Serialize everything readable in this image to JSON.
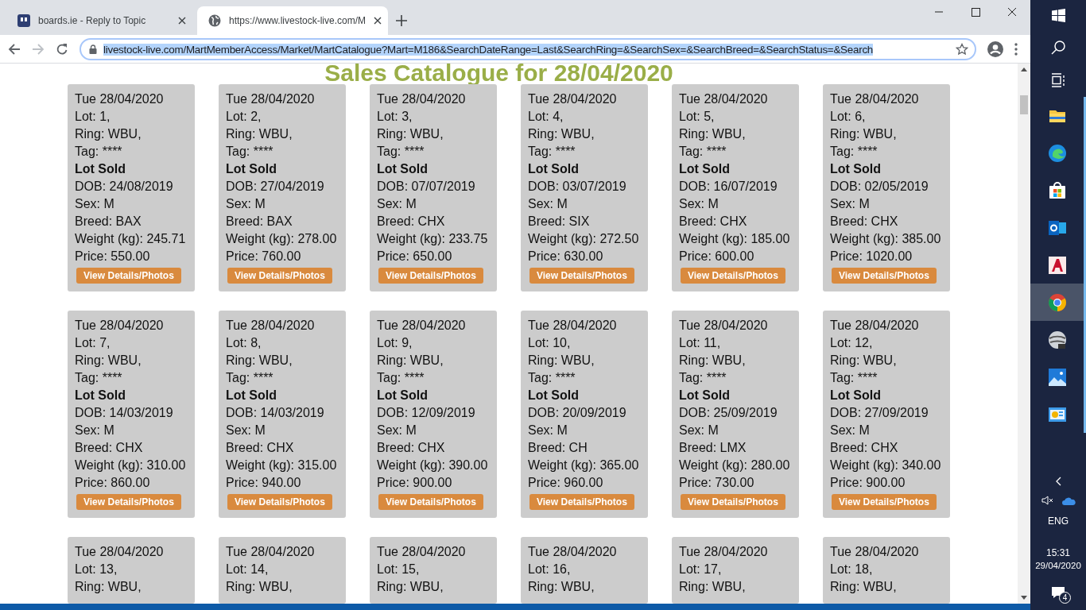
{
  "tabs": [
    {
      "title": "boards.ie - Reply to Topic",
      "selected": false
    },
    {
      "title": "https://www.livestock-live.com/M",
      "selected": true
    }
  ],
  "address_bar": {
    "url": "livestock-live.com/MartMemberAccess/Market/MartCatalogue?Mart=M186&SearchDateRange=Last&SearchRing=&SearchSex=&SearchBreed=&SearchStatus=&Search"
  },
  "page": {
    "title": "Sales Catalogue for 28/04/2020",
    "lots": [
      {
        "date": "Tue 28/04/2020",
        "lot": "Lot: 1,",
        "ring": "Ring: WBU,",
        "tag": "Tag: ****",
        "status": "Lot Sold",
        "dob": "DOB: 24/08/2019",
        "sex": "Sex: M",
        "breed": "Breed: BAX",
        "weight": "Weight (kg): 245.71",
        "price": "Price: 550.00",
        "button": "View Details/Photos"
      },
      {
        "date": "Tue 28/04/2020",
        "lot": "Lot: 2,",
        "ring": "Ring: WBU,",
        "tag": "Tag: ****",
        "status": "Lot Sold",
        "dob": "DOB: 27/04/2019",
        "sex": "Sex: M",
        "breed": "Breed: BAX",
        "weight": "Weight (kg): 278.00",
        "price": "Price: 760.00",
        "button": "View Details/Photos"
      },
      {
        "date": "Tue 28/04/2020",
        "lot": "Lot: 3,",
        "ring": "Ring: WBU,",
        "tag": "Tag: ****",
        "status": "Lot Sold",
        "dob": "DOB: 07/07/2019",
        "sex": "Sex: M",
        "breed": "Breed: CHX",
        "weight": "Weight (kg): 233.75",
        "price": "Price: 650.00",
        "button": "View Details/Photos"
      },
      {
        "date": "Tue 28/04/2020",
        "lot": "Lot: 4,",
        "ring": "Ring: WBU,",
        "tag": "Tag: ****",
        "status": "Lot Sold",
        "dob": "DOB: 03/07/2019",
        "sex": "Sex: M",
        "breed": "Breed: SIX",
        "weight": "Weight (kg): 272.50",
        "price": "Price: 630.00",
        "button": "View Details/Photos"
      },
      {
        "date": "Tue 28/04/2020",
        "lot": "Lot: 5,",
        "ring": "Ring: WBU,",
        "tag": "Tag: ****",
        "status": "Lot Sold",
        "dob": "DOB: 16/07/2019",
        "sex": "Sex: M",
        "breed": "Breed: CHX",
        "weight": "Weight (kg): 185.00",
        "price": "Price: 600.00",
        "button": "View Details/Photos"
      },
      {
        "date": "Tue 28/04/2020",
        "lot": "Lot: 6,",
        "ring": "Ring: WBU,",
        "tag": "Tag: ****",
        "status": "Lot Sold",
        "dob": "DOB: 02/05/2019",
        "sex": "Sex: M",
        "breed": "Breed: CHX",
        "weight": "Weight (kg): 385.00",
        "price": "Price: 1020.00",
        "button": "View Details/Photos"
      },
      {
        "date": "Tue 28/04/2020",
        "lot": "Lot: 7,",
        "ring": "Ring: WBU,",
        "tag": "Tag: ****",
        "status": "Lot Sold",
        "dob": "DOB: 14/03/2019",
        "sex": "Sex: M",
        "breed": "Breed: CHX",
        "weight": "Weight (kg): 310.00",
        "price": "Price: 860.00",
        "button": "View Details/Photos"
      },
      {
        "date": "Tue 28/04/2020",
        "lot": "Lot: 8,",
        "ring": "Ring: WBU,",
        "tag": "Tag: ****",
        "status": "Lot Sold",
        "dob": "DOB: 14/03/2019",
        "sex": "Sex: M",
        "breed": "Breed: CHX",
        "weight": "Weight (kg): 315.00",
        "price": "Price: 940.00",
        "button": "View Details/Photos"
      },
      {
        "date": "Tue 28/04/2020",
        "lot": "Lot: 9,",
        "ring": "Ring: WBU,",
        "tag": "Tag: ****",
        "status": "Lot Sold",
        "dob": "DOB: 12/09/2019",
        "sex": "Sex: M",
        "breed": "Breed: CHX",
        "weight": "Weight (kg): 390.00",
        "price": "Price: 900.00",
        "button": "View Details/Photos"
      },
      {
        "date": "Tue 28/04/2020",
        "lot": "Lot: 10,",
        "ring": "Ring: WBU,",
        "tag": "Tag: ****",
        "status": "Lot Sold",
        "dob": "DOB: 20/09/2019",
        "sex": "Sex: M",
        "breed": "Breed: CH",
        "weight": "Weight (kg): 365.00",
        "price": "Price: 960.00",
        "button": "View Details/Photos"
      },
      {
        "date": "Tue 28/04/2020",
        "lot": "Lot: 11,",
        "ring": "Ring: WBU,",
        "tag": "Tag: ****",
        "status": "Lot Sold",
        "dob": "DOB: 25/09/2019",
        "sex": "Sex: M",
        "breed": "Breed: LMX",
        "weight": "Weight (kg): 280.00",
        "price": "Price: 730.00",
        "button": "View Details/Photos"
      },
      {
        "date": "Tue 28/04/2020",
        "lot": "Lot: 12,",
        "ring": "Ring: WBU,",
        "tag": "Tag: ****",
        "status": "Lot Sold",
        "dob": "DOB: 27/09/2019",
        "sex": "Sex: M",
        "breed": "Breed: CHX",
        "weight": "Weight (kg): 340.00",
        "price": "Price: 900.00",
        "button": "View Details/Photos"
      },
      {
        "date": "Tue 28/04/2020",
        "lot": "Lot: 13,",
        "ring": "Ring: WBU,"
      },
      {
        "date": "Tue 28/04/2020",
        "lot": "Lot: 14,",
        "ring": "Ring: WBU,"
      },
      {
        "date": "Tue 28/04/2020",
        "lot": "Lot: 15,",
        "ring": "Ring: WBU,"
      },
      {
        "date": "Tue 28/04/2020",
        "lot": "Lot: 16,",
        "ring": "Ring: WBU,"
      },
      {
        "date": "Tue 28/04/2020",
        "lot": "Lot: 17,",
        "ring": "Ring: WBU,"
      },
      {
        "date": "Tue 28/04/2020",
        "lot": "Lot: 18,",
        "ring": "Ring: WBU,"
      }
    ]
  },
  "taskbar": {
    "apps": [
      {
        "kind": "folder",
        "selected": false
      },
      {
        "kind": "edge",
        "selected": false
      },
      {
        "kind": "store",
        "selected": false
      },
      {
        "kind": "mail",
        "selected": false
      },
      {
        "kind": "cad",
        "selected": false
      },
      {
        "kind": "chrome",
        "selected": true
      },
      {
        "kind": "globe",
        "selected": false
      },
      {
        "kind": "photos",
        "selected": false
      },
      {
        "kind": "presentation",
        "selected": false
      }
    ],
    "tray": {
      "language": "ENG",
      "time": "15:31",
      "date": "29/04/2020",
      "notifications": "4"
    }
  }
}
